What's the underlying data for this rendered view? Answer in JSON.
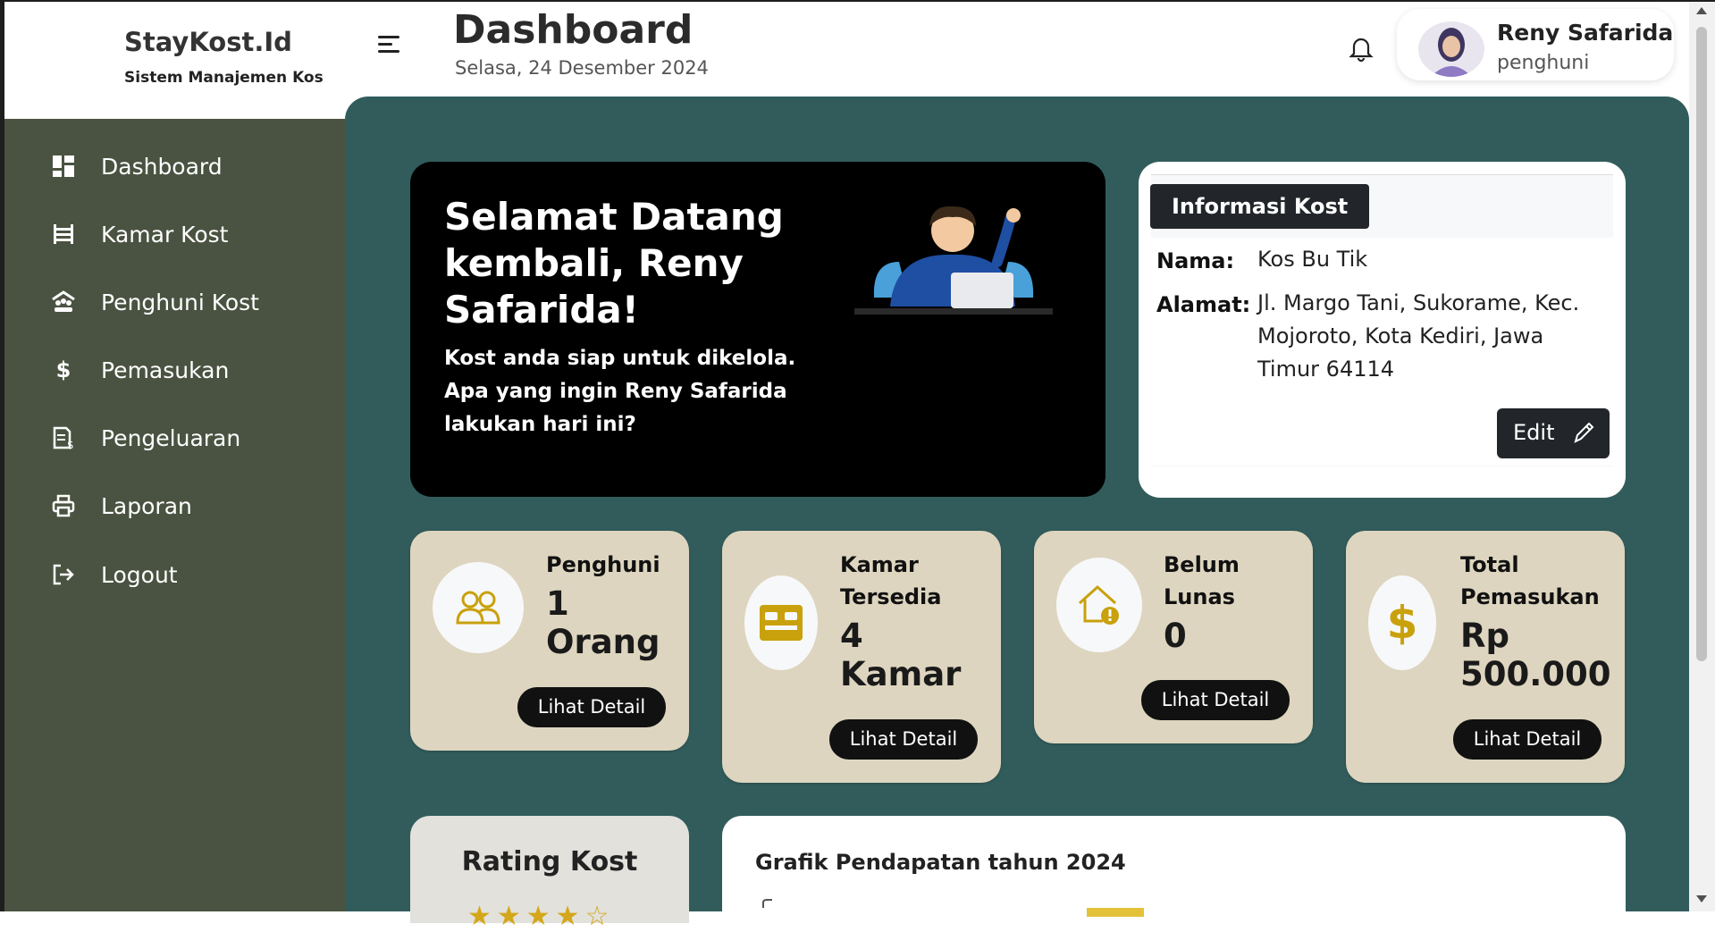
{
  "brand": {
    "title": "StayKost.Id",
    "subtitle": "Sistem Manajemen Kos"
  },
  "header": {
    "title": "Dashboard",
    "date": "Selasa, 24 Desember 2024"
  },
  "user": {
    "name": "Reny Safarida",
    "role": "penghuni"
  },
  "sidebar": {
    "items": [
      {
        "label": "Dashboard",
        "icon": "dashboard-icon"
      },
      {
        "label": "Kamar Kost",
        "icon": "bed-icon"
      },
      {
        "label": "Penghuni Kost",
        "icon": "people-roof-icon"
      },
      {
        "label": "Pemasukan",
        "icon": "dollar-icon"
      },
      {
        "label": "Pengeluaran",
        "icon": "receipt-icon"
      },
      {
        "label": "Laporan",
        "icon": "printer-icon"
      },
      {
        "label": "Logout",
        "icon": "logout-icon"
      }
    ]
  },
  "welcome": {
    "title": "Selamat Datang kembali, Reny Safarida!",
    "subtitle": "Kost anda siap untuk dikelola. Apa yang ingin Reny Safarida lakukan hari ini?"
  },
  "info": {
    "tab": "Informasi Kost",
    "name_label": "Nama:",
    "name_value": "Kos Bu Tik",
    "address_label": "Alamat:",
    "address_value": "Jl. Margo Tani, Sukorame, Kec. Mojoroto, Kota Kediri, Jawa Timur 64114",
    "edit_label": "Edit"
  },
  "stats": [
    {
      "label": "Penghuni",
      "value": "1 Orang",
      "button": "Lihat Detail",
      "icon": "users-icon"
    },
    {
      "label": "Kamar Tersedia",
      "value": "4 Kamar",
      "button": "Lihat Detail",
      "icon": "bed-icon"
    },
    {
      "label": "Belum Lunas",
      "value": "0",
      "button": "Lihat Detail",
      "icon": "house-alert-icon"
    },
    {
      "label": "Total Pemasukan",
      "value": "Rp 500.000",
      "button": "Lihat Detail",
      "icon": "dollar-icon"
    }
  ],
  "rating": {
    "title": "Rating Kost",
    "stars": "★★★★☆"
  },
  "chart": {
    "title": "Grafik Pendapatan tahun 2024"
  },
  "colors": {
    "sidebar": "#4a5341",
    "main": "#325c5c",
    "card": "#ddd5bf",
    "icon_accent": "#c9a10c"
  }
}
